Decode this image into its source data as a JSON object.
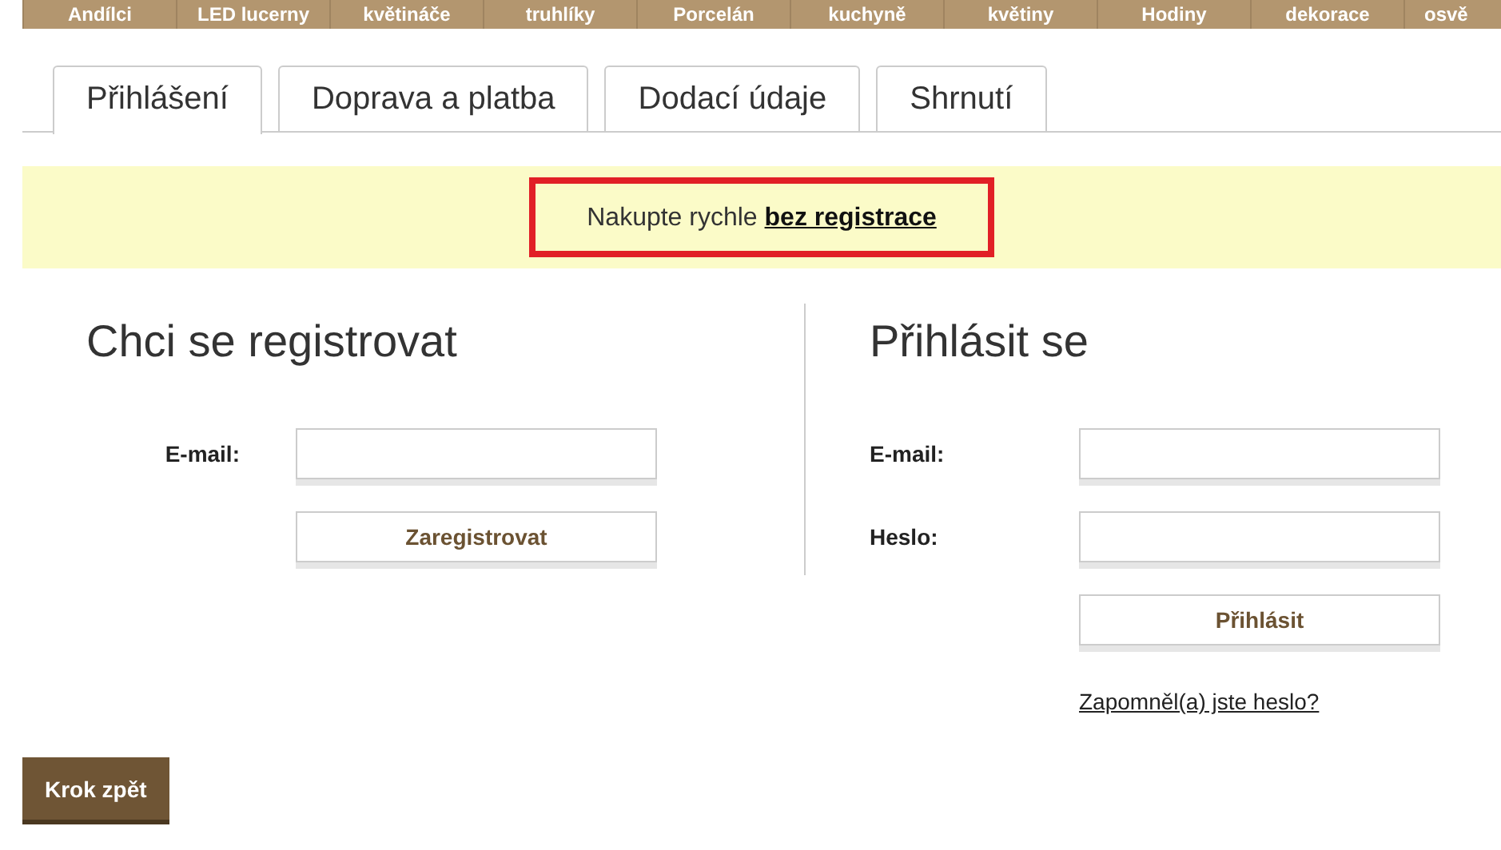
{
  "nav": {
    "items": [
      {
        "label": "Andílci"
      },
      {
        "label": "LED lucerny"
      },
      {
        "label": "květináče"
      },
      {
        "label": "truhlíky"
      },
      {
        "label": "Porcelán"
      },
      {
        "label": "kuchyně"
      },
      {
        "label": "květiny"
      },
      {
        "label": "Hodiny"
      },
      {
        "label": "dekorace"
      },
      {
        "label": "osvě"
      }
    ]
  },
  "tabs": [
    {
      "label": "Přihlášení",
      "selected": true
    },
    {
      "label": "Doprava a platba",
      "selected": false
    },
    {
      "label": "Dodací údaje",
      "selected": false
    },
    {
      "label": "Shrnutí",
      "selected": false
    }
  ],
  "banner": {
    "text": "Nakupte rychle **bez registrace**"
  },
  "register": {
    "title": "Chci se registrovat",
    "fields": [
      {
        "label": "E-mail:"
      }
    ],
    "button": "Zaregistrovat"
  },
  "login": {
    "title": "Přihlásit se",
    "fields": [
      {
        "label": "E-mail:"
      },
      {
        "label": "Heslo:"
      }
    ],
    "button": "Přihlásit",
    "link": "Zapomněl(a) jste heslo?"
  },
  "back_button": "Krok zpět"
}
